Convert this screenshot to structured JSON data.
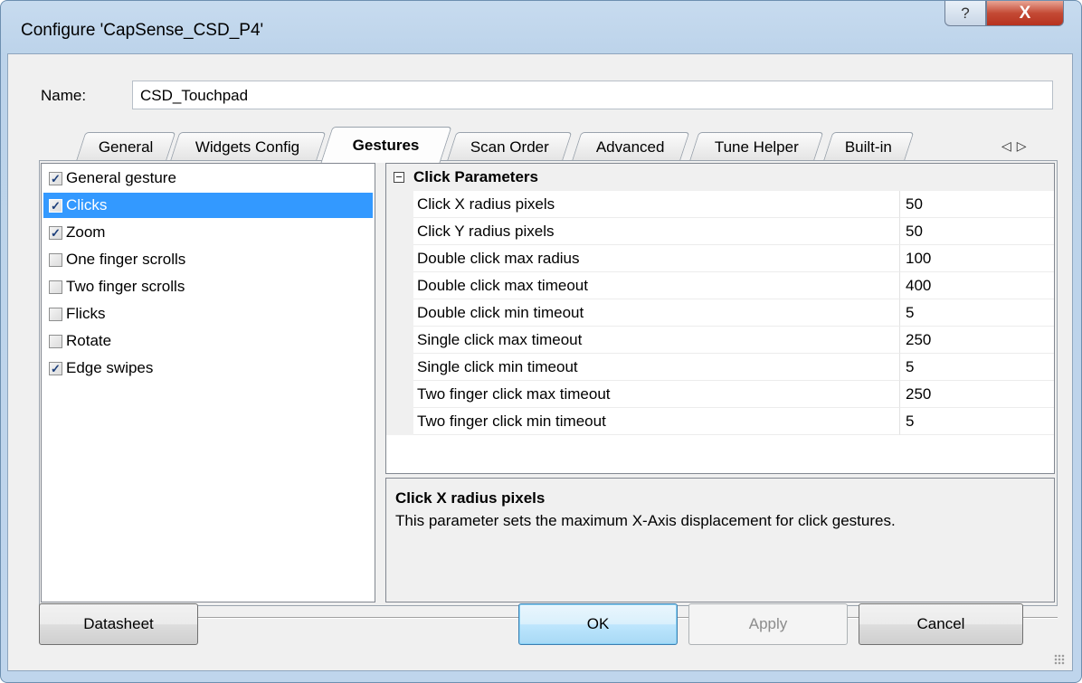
{
  "window": {
    "title": "Configure 'CapSense_CSD_P4'",
    "help_glyph": "?",
    "close_glyph": "X"
  },
  "name": {
    "label": "Name:",
    "value": "CSD_Touchpad"
  },
  "tabs": [
    {
      "label": "General"
    },
    {
      "label": "Widgets Config"
    },
    {
      "label": "Gestures"
    },
    {
      "label": "Scan Order"
    },
    {
      "label": "Advanced"
    },
    {
      "label": "Tune Helper"
    },
    {
      "label": "Built-in"
    }
  ],
  "tab_scroll": {
    "left_glyph": "◁",
    "right_glyph": "▷"
  },
  "gestures": [
    {
      "label": "General gesture",
      "checked": true,
      "selected": false
    },
    {
      "label": "Clicks",
      "checked": true,
      "selected": true
    },
    {
      "label": "Zoom",
      "checked": true,
      "selected": false
    },
    {
      "label": "One finger scrolls",
      "checked": false,
      "selected": false
    },
    {
      "label": "Two finger scrolls",
      "checked": false,
      "selected": false
    },
    {
      "label": "Flicks",
      "checked": false,
      "selected": false
    },
    {
      "label": "Rotate",
      "checked": false,
      "selected": false
    },
    {
      "label": "Edge swipes",
      "checked": true,
      "selected": false
    }
  ],
  "properties": {
    "category": "Click Parameters",
    "rows": [
      {
        "name": "Click X radius pixels",
        "value": "50"
      },
      {
        "name": "Click Y radius pixels",
        "value": "50"
      },
      {
        "name": "Double click max radius",
        "value": "100"
      },
      {
        "name": "Double click max timeout",
        "value": "400"
      },
      {
        "name": "Double click min timeout",
        "value": "5"
      },
      {
        "name": "Single click max timeout",
        "value": "250"
      },
      {
        "name": "Single click min timeout",
        "value": "5"
      },
      {
        "name": "Two finger click max timeout",
        "value": "250"
      },
      {
        "name": "Two finger click min timeout",
        "value": "5"
      }
    ]
  },
  "description": {
    "title": "Click X radius pixels",
    "text": "This parameter sets the maximum X-Axis displacement for click gestures."
  },
  "buttons": {
    "datasheet": "Datasheet",
    "ok": "OK",
    "apply": "Apply",
    "cancel": "Cancel"
  }
}
